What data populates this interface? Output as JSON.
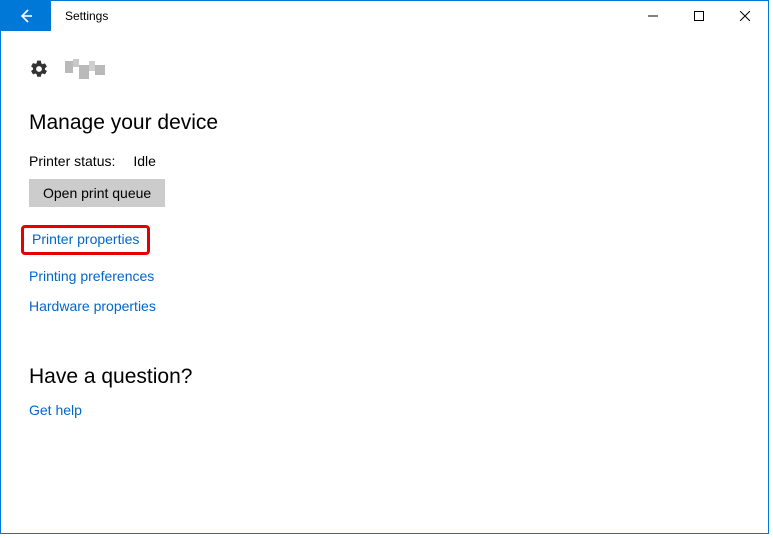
{
  "titlebar": {
    "title": "Settings"
  },
  "sections": {
    "manage": "Manage your device",
    "question": "Have a question?"
  },
  "status": {
    "label": "Printer status:",
    "value": "Idle"
  },
  "buttons": {
    "open_queue": "Open print queue"
  },
  "links": {
    "printer_properties": "Printer properties",
    "printing_preferences": "Printing preferences",
    "hardware_properties": "Hardware properties",
    "get_help": "Get help"
  }
}
